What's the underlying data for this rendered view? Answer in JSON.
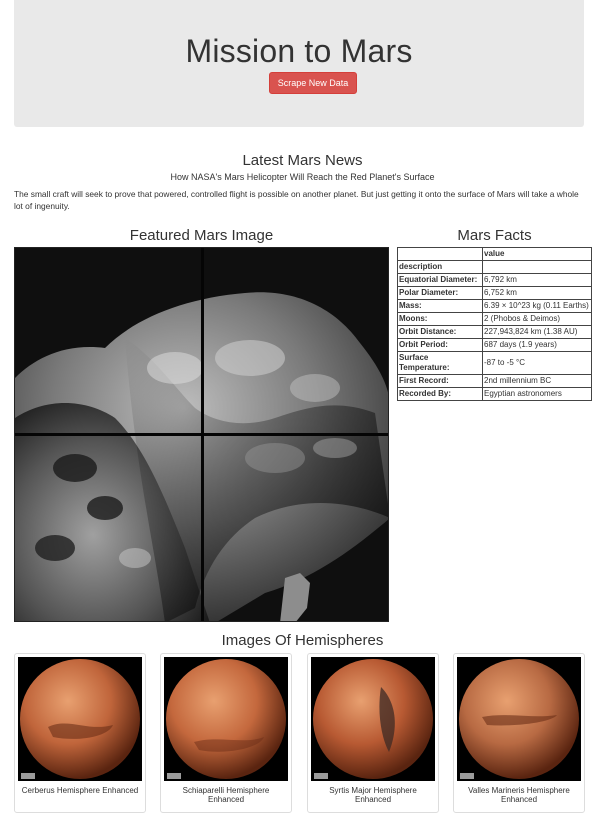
{
  "header": {
    "title": "Mission to Mars",
    "scrape_button": "Scrape New Data"
  },
  "news": {
    "heading": "Latest Mars News",
    "title": "How NASA's Mars Helicopter Will Reach the Red Planet's Surface",
    "paragraph": "The small craft will seek to prove that powered, controlled flight is possible on another planet. But just getting it onto the surface of Mars will take a whole lot of ingenuity."
  },
  "featured": {
    "heading": "Featured Mars Image"
  },
  "facts": {
    "heading": "Mars Facts",
    "column_header": "value",
    "index_header": "description",
    "rows": [
      {
        "label": "Equatorial Diameter:",
        "value": "6,792 km"
      },
      {
        "label": "Polar Diameter:",
        "value": "6,752 km"
      },
      {
        "label": "Mass:",
        "value": "6.39 × 10^23 kg (0.11 Earths)"
      },
      {
        "label": "Moons:",
        "value": "2 (Phobos & Deimos)"
      },
      {
        "label": "Orbit Distance:",
        "value": "227,943,824 km (1.38 AU)"
      },
      {
        "label": "Orbit Period:",
        "value": "687 days (1.9 years)"
      },
      {
        "label": "Surface Temperature:",
        "value": "-87 to -5 °C"
      },
      {
        "label": "First Record:",
        "value": "2nd millennium BC"
      },
      {
        "label": "Recorded By:",
        "value": "Egyptian astronomers"
      }
    ]
  },
  "hemispheres": {
    "heading": "Images Of Hemispheres",
    "items": [
      {
        "title": "Cerberus Hemisphere Enhanced",
        "color": "#c0653b"
      },
      {
        "title": "Schiaparelli Hemisphere Enhanced",
        "color": "#c4683d"
      },
      {
        "title": "Syrtis Major Hemisphere Enhanced",
        "color": "#b85a33"
      },
      {
        "title": "Valles Marineris Hemisphere Enhanced",
        "color": "#b86a43"
      }
    ]
  }
}
